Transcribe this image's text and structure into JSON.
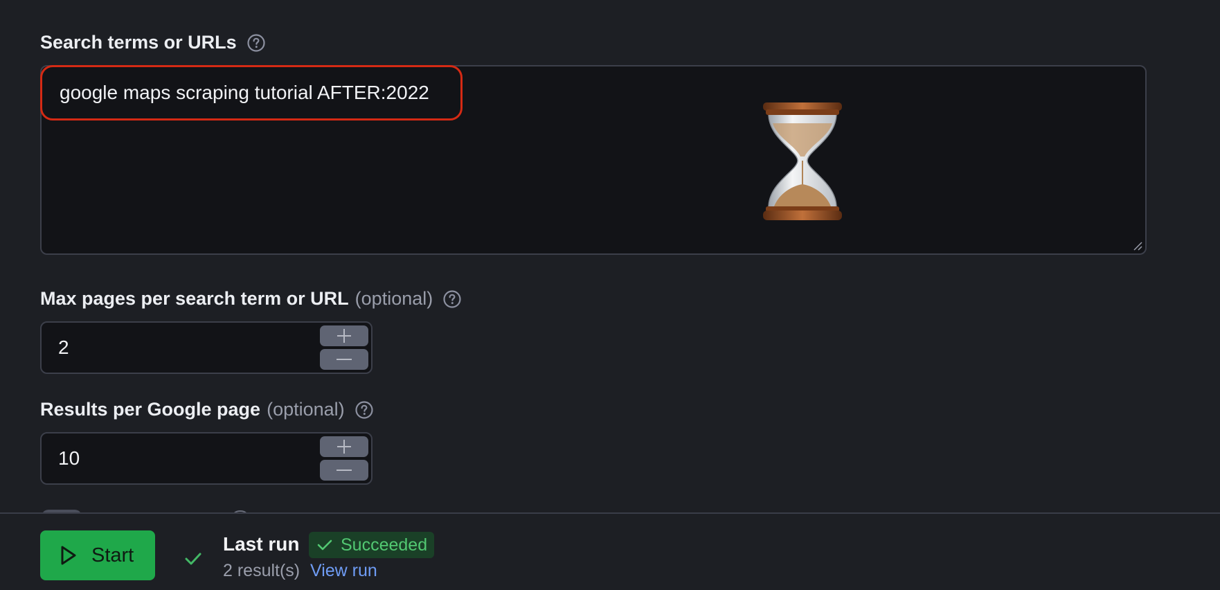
{
  "search_terms": {
    "label": "Search terms or URLs",
    "value": "google maps scraping tutorial AFTER:2022",
    "overlay_icon": "hourglass-icon",
    "help_icon": "question-circle-icon"
  },
  "max_pages": {
    "label": "Max pages per search term or URL",
    "optional": "(optional)",
    "value": "2"
  },
  "results_per_page": {
    "label": "Results per Google page",
    "optional": "(optional)",
    "value": "10"
  },
  "footer": {
    "start_label": "Start",
    "last_run_title": "Last run",
    "status": "Succeeded",
    "result_count": "2 result(s)",
    "view_run_label": "View run"
  },
  "colors": {
    "background": "#1d1f24",
    "input_background": "#121317",
    "accent_green": "#1fa84a",
    "success_text": "#52c872",
    "link_blue": "#6f9cf5",
    "highlight_red": "#d52a14"
  }
}
